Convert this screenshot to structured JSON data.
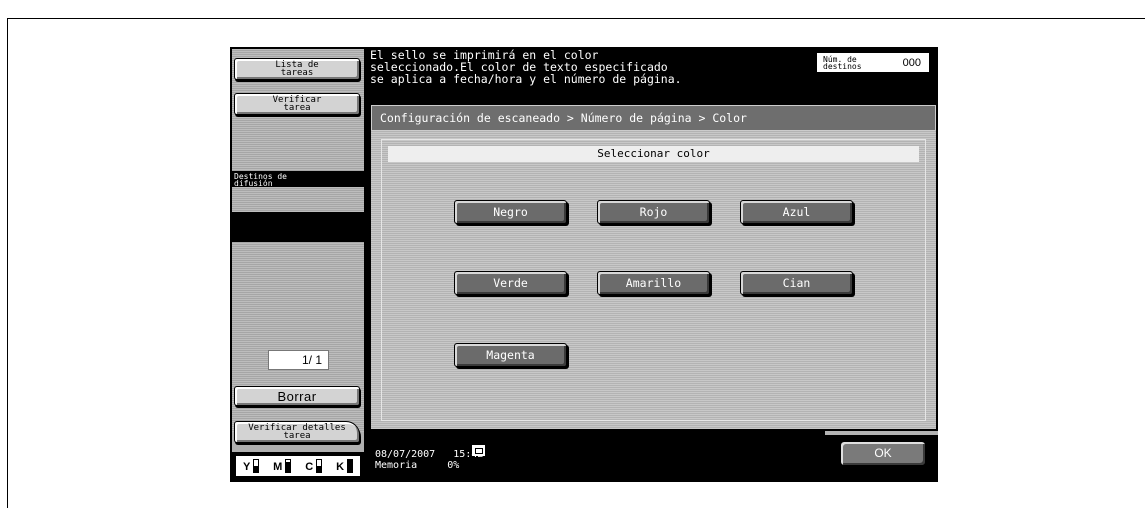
{
  "sidebar": {
    "lista_tareas": "Lista de tareas",
    "verificar_tarea": "Verificar tarea",
    "destinos_difusion": "Destinos de difusión",
    "page_counter": "1/ 1",
    "borrar": "Borrar",
    "verificar_detalles": "Verificar detalles tarea"
  },
  "toner": [
    {
      "label": "Y",
      "level": 0.5
    },
    {
      "label": "M",
      "level": 0.8
    },
    {
      "label": "C",
      "level": 0.5
    },
    {
      "label": "K",
      "level": 1.0
    }
  ],
  "message": {
    "line1": "El sello se imprimirá en el color",
    "line2": "seleccionado.El color de texto especificado",
    "line3": "se aplica a fecha/hora y el número de página."
  },
  "destinations": {
    "label_line1": "Núm. de",
    "label_line2": "destinos",
    "value": "000"
  },
  "breadcrumb": "Configuración de escaneado > Número de página > Color",
  "section_title": "Seleccionar color",
  "colors": {
    "negro": "Negro",
    "rojo": "Rojo",
    "azul": "Azul",
    "verde": "Verde",
    "amarillo": "Amarillo",
    "cian": "Cian",
    "magenta": "Magenta"
  },
  "status": {
    "date": "08/07/2007",
    "time": "15:42",
    "memory_label": "Memoria",
    "memory_value": "0%"
  },
  "ok_label": "OK"
}
